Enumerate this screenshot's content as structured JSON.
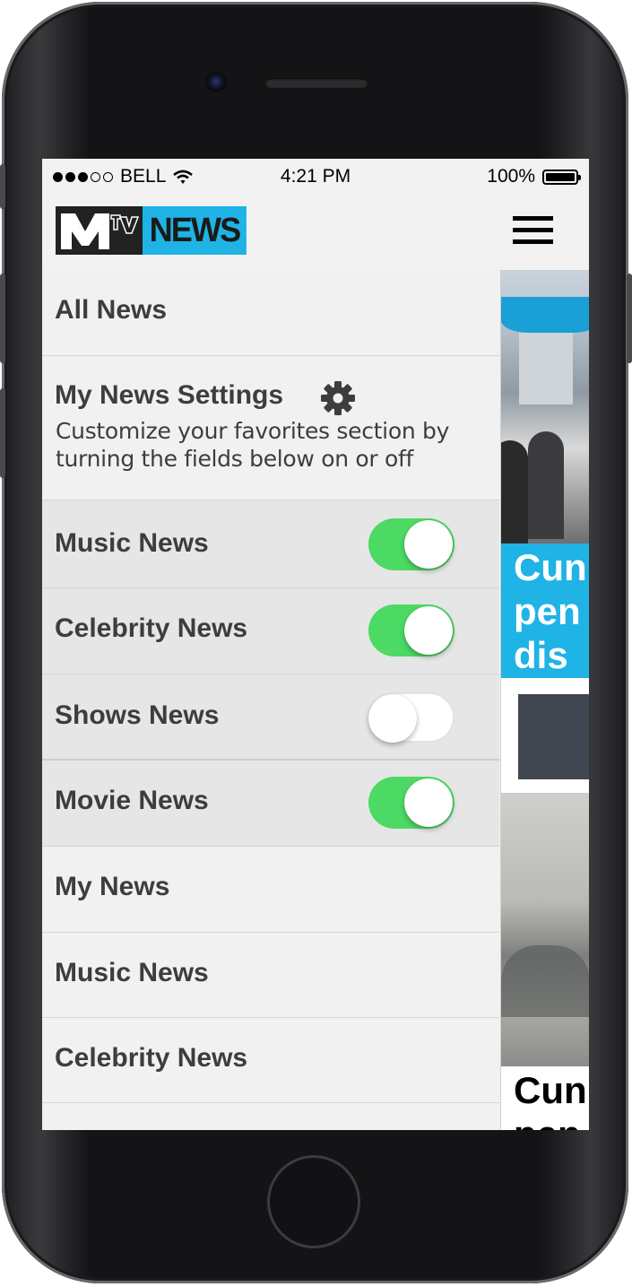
{
  "status_bar": {
    "carrier": "BELL",
    "time": "4:21 PM",
    "battery": "100%"
  },
  "header": {
    "logo_brand": "MTV",
    "logo_text": "NEWS"
  },
  "drawer": {
    "all_news": "All News",
    "settings_title": "My News Settings",
    "settings_description": "Customize your favorites section by turning the fields below on or off",
    "toggles": [
      {
        "label": "Music News",
        "on": true
      },
      {
        "label": "Celebrity News",
        "on": true
      },
      {
        "label": "Shows News",
        "on": false
      },
      {
        "label": "Movie News",
        "on": true
      }
    ],
    "links": [
      "My News",
      "Music News",
      "Celebrity News"
    ]
  },
  "content_peek": {
    "headline1_lines": [
      "Cun",
      "pen",
      "dis"
    ],
    "headline2_lines": [
      "Cun",
      "pen"
    ]
  },
  "colors": {
    "toggle_on": "#4cd964",
    "brand_blue": "#1fb3e6",
    "text": "#3d3d3d"
  },
  "icons": {
    "settings": "gear-icon",
    "menu": "hamburger-menu-icon",
    "wifi": "wifi-icon",
    "battery": "battery-icon"
  }
}
